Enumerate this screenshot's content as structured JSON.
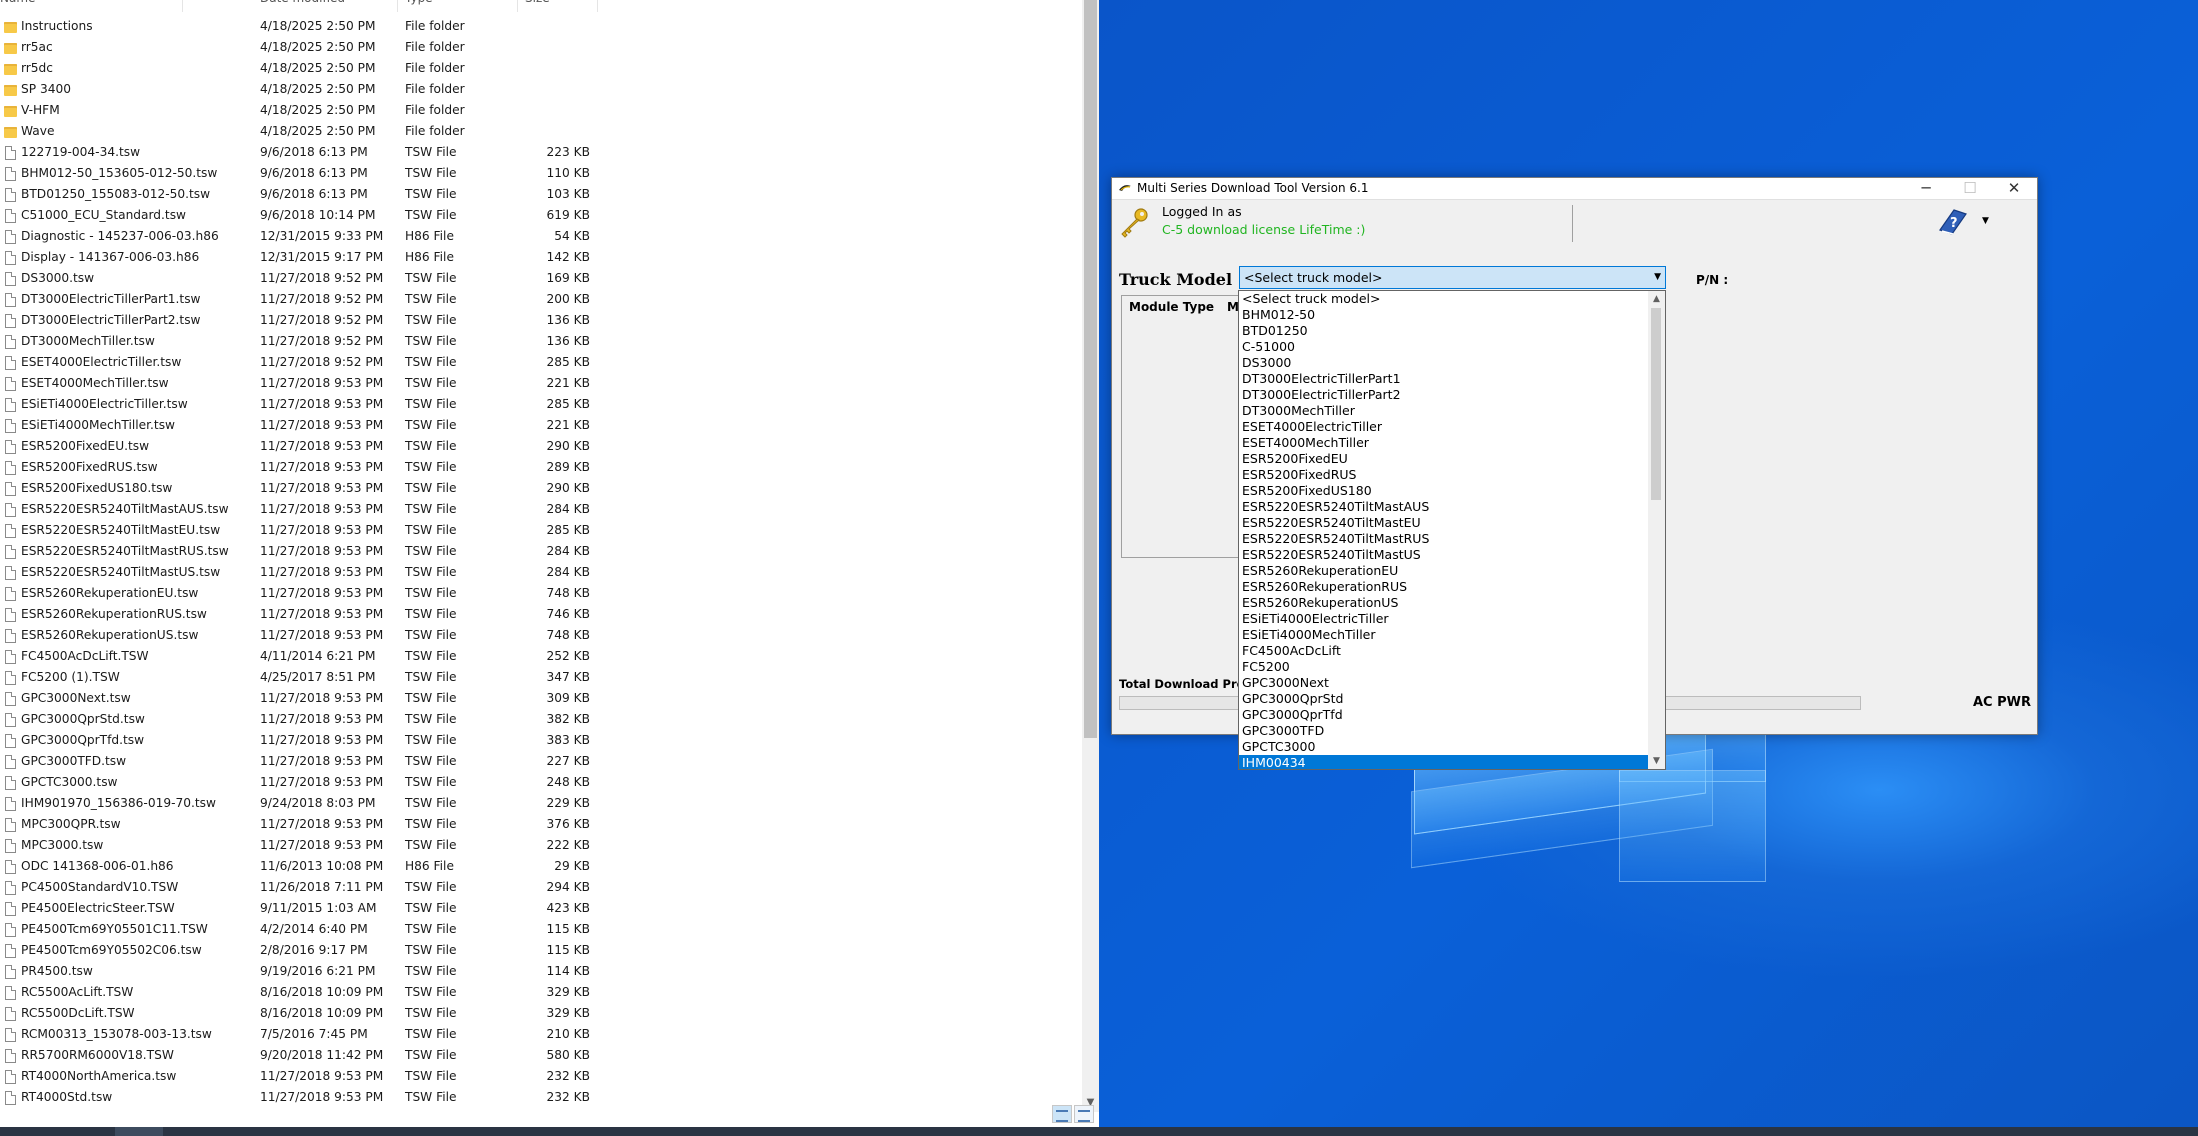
{
  "explorer": {
    "columns": {
      "name": "Name",
      "date": "Date modified",
      "type": "Type",
      "size": "Size"
    },
    "files": [
      {
        "kind": "folder",
        "name": "Instructions",
        "date": "4/18/2025 2:50 PM",
        "type": "File folder",
        "size": ""
      },
      {
        "kind": "folder",
        "name": "rr5ac",
        "date": "4/18/2025 2:50 PM",
        "type": "File folder",
        "size": ""
      },
      {
        "kind": "folder",
        "name": "rr5dc",
        "date": "4/18/2025 2:50 PM",
        "type": "File folder",
        "size": ""
      },
      {
        "kind": "folder",
        "name": "SP 3400",
        "date": "4/18/2025 2:50 PM",
        "type": "File folder",
        "size": ""
      },
      {
        "kind": "folder",
        "name": "V-HFM",
        "date": "4/18/2025 2:50 PM",
        "type": "File folder",
        "size": ""
      },
      {
        "kind": "folder",
        "name": "Wave",
        "date": "4/18/2025 2:50 PM",
        "type": "File folder",
        "size": ""
      },
      {
        "kind": "file",
        "name": "122719-004-34.tsw",
        "date": "9/6/2018 6:13 PM",
        "type": "TSW File",
        "size": "223 KB"
      },
      {
        "kind": "file",
        "name": "BHM012-50_153605-012-50.tsw",
        "date": "9/6/2018 6:13 PM",
        "type": "TSW File",
        "size": "110 KB"
      },
      {
        "kind": "file",
        "name": "BTD01250_155083-012-50.tsw",
        "date": "9/6/2018 6:13 PM",
        "type": "TSW File",
        "size": "103 KB"
      },
      {
        "kind": "file",
        "name": "C51000_ECU_Standard.tsw",
        "date": "9/6/2018 10:14 PM",
        "type": "TSW File",
        "size": "619 KB"
      },
      {
        "kind": "file",
        "name": "Diagnostic - 145237-006-03.h86",
        "date": "12/31/2015 9:33 PM",
        "type": "H86 File",
        "size": "54 KB"
      },
      {
        "kind": "file",
        "name": "Display - 141367-006-03.h86",
        "date": "12/31/2015 9:17 PM",
        "type": "H86 File",
        "size": "142 KB"
      },
      {
        "kind": "file",
        "name": "DS3000.tsw",
        "date": "11/27/2018 9:52 PM",
        "type": "TSW File",
        "size": "169 KB"
      },
      {
        "kind": "file",
        "name": "DT3000ElectricTillerPart1.tsw",
        "date": "11/27/2018 9:52 PM",
        "type": "TSW File",
        "size": "200 KB"
      },
      {
        "kind": "file",
        "name": "DT3000ElectricTillerPart2.tsw",
        "date": "11/27/2018 9:52 PM",
        "type": "TSW File",
        "size": "136 KB"
      },
      {
        "kind": "file",
        "name": "DT3000MechTiller.tsw",
        "date": "11/27/2018 9:52 PM",
        "type": "TSW File",
        "size": "136 KB"
      },
      {
        "kind": "file",
        "name": "ESET4000ElectricTiller.tsw",
        "date": "11/27/2018 9:52 PM",
        "type": "TSW File",
        "size": "285 KB"
      },
      {
        "kind": "file",
        "name": "ESET4000MechTiller.tsw",
        "date": "11/27/2018 9:53 PM",
        "type": "TSW File",
        "size": "221 KB"
      },
      {
        "kind": "file",
        "name": "ESiETi4000ElectricTiller.tsw",
        "date": "11/27/2018 9:53 PM",
        "type": "TSW File",
        "size": "285 KB"
      },
      {
        "kind": "file",
        "name": "ESiETi4000MechTiller.tsw",
        "date": "11/27/2018 9:53 PM",
        "type": "TSW File",
        "size": "221 KB"
      },
      {
        "kind": "file",
        "name": "ESR5200FixedEU.tsw",
        "date": "11/27/2018 9:53 PM",
        "type": "TSW File",
        "size": "290 KB"
      },
      {
        "kind": "file",
        "name": "ESR5200FixedRUS.tsw",
        "date": "11/27/2018 9:53 PM",
        "type": "TSW File",
        "size": "289 KB"
      },
      {
        "kind": "file",
        "name": "ESR5200FixedUS180.tsw",
        "date": "11/27/2018 9:53 PM",
        "type": "TSW File",
        "size": "290 KB"
      },
      {
        "kind": "file",
        "name": "ESR5220ESR5240TiltMastAUS.tsw",
        "date": "11/27/2018 9:53 PM",
        "type": "TSW File",
        "size": "284 KB"
      },
      {
        "kind": "file",
        "name": "ESR5220ESR5240TiltMastEU.tsw",
        "date": "11/27/2018 9:53 PM",
        "type": "TSW File",
        "size": "285 KB"
      },
      {
        "kind": "file",
        "name": "ESR5220ESR5240TiltMastRUS.tsw",
        "date": "11/27/2018 9:53 PM",
        "type": "TSW File",
        "size": "284 KB"
      },
      {
        "kind": "file",
        "name": "ESR5220ESR5240TiltMastUS.tsw",
        "date": "11/27/2018 9:53 PM",
        "type": "TSW File",
        "size": "284 KB"
      },
      {
        "kind": "file",
        "name": "ESR5260RekuperationEU.tsw",
        "date": "11/27/2018 9:53 PM",
        "type": "TSW File",
        "size": "748 KB"
      },
      {
        "kind": "file",
        "name": "ESR5260RekuperationRUS.tsw",
        "date": "11/27/2018 9:53 PM",
        "type": "TSW File",
        "size": "746 KB"
      },
      {
        "kind": "file",
        "name": "ESR5260RekuperationUS.tsw",
        "date": "11/27/2018 9:53 PM",
        "type": "TSW File",
        "size": "748 KB"
      },
      {
        "kind": "file",
        "name": "FC4500AcDcLift.TSW",
        "date": "4/11/2014 6:21 PM",
        "type": "TSW File",
        "size": "252 KB"
      },
      {
        "kind": "file",
        "name": "FC5200 (1).TSW",
        "date": "4/25/2017 8:51 PM",
        "type": "TSW File",
        "size": "347 KB"
      },
      {
        "kind": "file",
        "name": "GPC3000Next.tsw",
        "date": "11/27/2018 9:53 PM",
        "type": "TSW File",
        "size": "309 KB"
      },
      {
        "kind": "file",
        "name": "GPC3000QprStd.tsw",
        "date": "11/27/2018 9:53 PM",
        "type": "TSW File",
        "size": "382 KB"
      },
      {
        "kind": "file",
        "name": "GPC3000QprTfd.tsw",
        "date": "11/27/2018 9:53 PM",
        "type": "TSW File",
        "size": "383 KB"
      },
      {
        "kind": "file",
        "name": "GPC3000TFD.tsw",
        "date": "11/27/2018 9:53 PM",
        "type": "TSW File",
        "size": "227 KB"
      },
      {
        "kind": "file",
        "name": "GPCTC3000.tsw",
        "date": "11/27/2018 9:53 PM",
        "type": "TSW File",
        "size": "248 KB"
      },
      {
        "kind": "file",
        "name": "IHM901970_156386-019-70.tsw",
        "date": "9/24/2018 8:03 PM",
        "type": "TSW File",
        "size": "229 KB"
      },
      {
        "kind": "file",
        "name": "MPC300QPR.tsw",
        "date": "11/27/2018 9:53 PM",
        "type": "TSW File",
        "size": "376 KB"
      },
      {
        "kind": "file",
        "name": "MPC3000.tsw",
        "date": "11/27/2018 9:53 PM",
        "type": "TSW File",
        "size": "222 KB"
      },
      {
        "kind": "file",
        "name": "ODC 141368-006-01.h86",
        "date": "11/6/2013 10:08 PM",
        "type": "H86 File",
        "size": "29 KB"
      },
      {
        "kind": "file",
        "name": "PC4500StandardV10.TSW",
        "date": "11/26/2018 7:11 PM",
        "type": "TSW File",
        "size": "294 KB"
      },
      {
        "kind": "file",
        "name": "PE4500ElectricSteer.TSW",
        "date": "9/11/2015 1:03 AM",
        "type": "TSW File",
        "size": "423 KB"
      },
      {
        "kind": "file",
        "name": "PE4500Tcm69Y05501C11.TSW",
        "date": "4/2/2014 6:40 PM",
        "type": "TSW File",
        "size": "115 KB"
      },
      {
        "kind": "file",
        "name": "PE4500Tcm69Y05502C06.tsw",
        "date": "2/8/2016 9:17 PM",
        "type": "TSW File",
        "size": "115 KB"
      },
      {
        "kind": "file",
        "name": "PR4500.tsw",
        "date": "9/19/2016 6:21 PM",
        "type": "TSW File",
        "size": "114 KB"
      },
      {
        "kind": "file",
        "name": "RC5500AcLift.TSW",
        "date": "8/16/2018 10:09 PM",
        "type": "TSW File",
        "size": "329 KB"
      },
      {
        "kind": "file",
        "name": "RC5500DcLift.TSW",
        "date": "8/16/2018 10:09 PM",
        "type": "TSW File",
        "size": "329 KB"
      },
      {
        "kind": "file",
        "name": "RCM00313_153078-003-13.tsw",
        "date": "7/5/2016 7:45 PM",
        "type": "TSW File",
        "size": "210 KB"
      },
      {
        "kind": "file",
        "name": "RR5700RM6000V18.TSW",
        "date": "9/20/2018 11:42 PM",
        "type": "TSW File",
        "size": "580 KB"
      },
      {
        "kind": "file",
        "name": "RT4000NorthAmerica.tsw",
        "date": "11/27/2018 9:53 PM",
        "type": "TSW File",
        "size": "232 KB"
      },
      {
        "kind": "file",
        "name": "RT4000Std.tsw",
        "date": "11/27/2018 9:53 PM",
        "type": "TSW File",
        "size": "232 KB"
      }
    ]
  },
  "app": {
    "title": "Multi Series Download Tool Version 6.1",
    "window_controls": {
      "minimize": "─",
      "maximize": "☐",
      "close": "✕"
    },
    "logged_in_label": "Logged In as",
    "license_text": "C-5 download license LifeTime :)",
    "license_color": "#21b521",
    "truck_model_label": "Truck Model",
    "truck_model_selected": "<Select truck model>",
    "pn_label": "P/N :",
    "module_type_header": "Module Type",
    "module_second_header": "M",
    "total_progress_label": "Total Download Progress",
    "progress": 0,
    "ac_pwr": "AC PWR"
  },
  "dropdown": {
    "selected_index": 29,
    "options": [
      "<Select truck model>",
      "BHM012-50",
      "BTD01250",
      "C-51000",
      "DS3000",
      "DT3000ElectricTillerPart1",
      "DT3000ElectricTillerPart2",
      "DT3000MechTiller",
      "ESET4000ElectricTiller",
      "ESET4000MechTiller",
      "ESR5200FixedEU",
      "ESR5200FixedRUS",
      "ESR5200FixedUS180",
      "ESR5220ESR5240TiltMastAUS",
      "ESR5220ESR5240TiltMastEU",
      "ESR5220ESR5240TiltMastRUS",
      "ESR5220ESR5240TiltMastUS",
      "ESR5260RekuperationEU",
      "ESR5260RekuperationRUS",
      "ESR5260RekuperationUS",
      "ESiETi4000ElectricTiller",
      "ESiETi4000MechTiller",
      "FC4500AcDcLift",
      "FC5200",
      "GPC3000Next",
      "GPC3000QprStd",
      "GPC3000QprTfd",
      "GPC3000TFD",
      "GPCTC3000",
      "IHM00434"
    ]
  }
}
